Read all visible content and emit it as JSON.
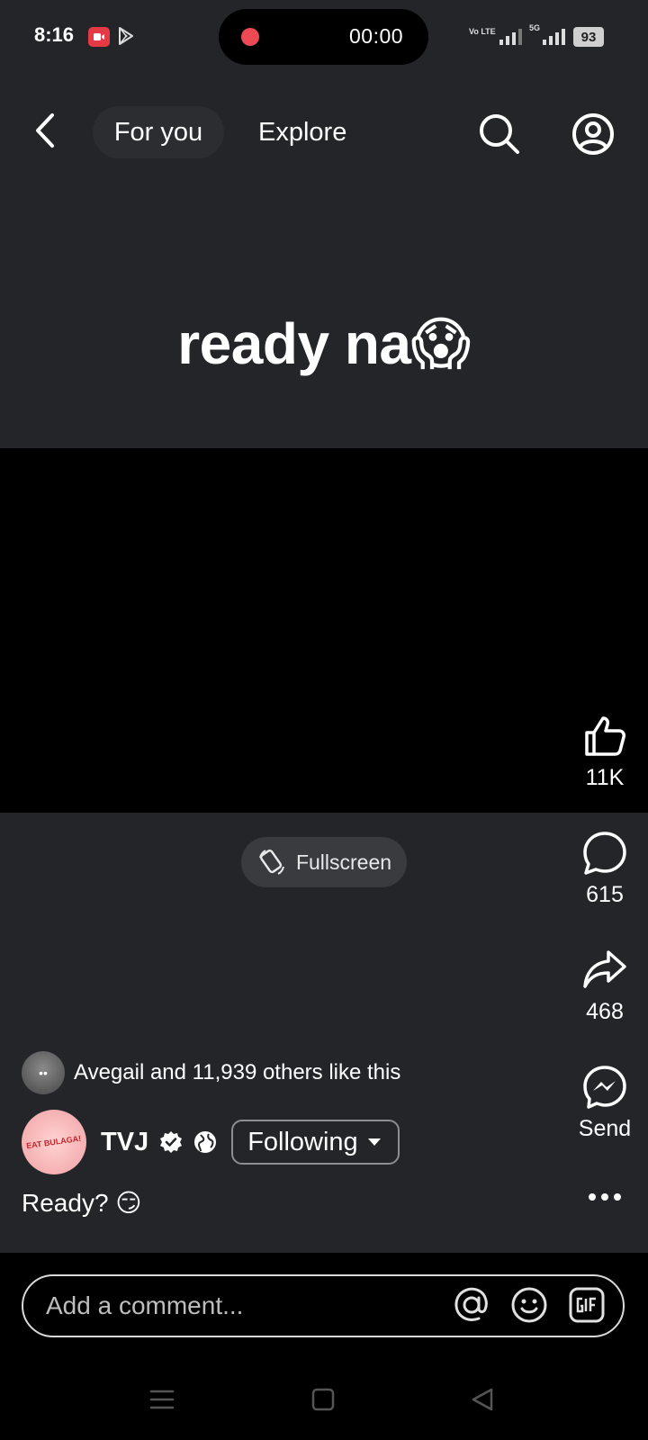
{
  "status_bar": {
    "time": "8:16",
    "screen_record_timer": "00:00",
    "network_volte": "Vo LTE",
    "network_5g": "5G",
    "battery": "93"
  },
  "top_nav": {
    "tab_for_you": "For you",
    "tab_explore": "Explore"
  },
  "video": {
    "caption": "ready na😱"
  },
  "fullscreen_label": "Fullscreen",
  "actions": {
    "like_count": "11K",
    "comment_count": "615",
    "share_count": "468",
    "send_label": "Send"
  },
  "post": {
    "likes_avatar_initials": "••",
    "likes_text": "Avegail and 11,939 others like this",
    "author_logo_text": "EAT BULAGA!",
    "author_name": "TVJ",
    "follow_state": "Following",
    "text": "Ready? 😏"
  },
  "comment_bar": {
    "placeholder": "Add a comment..."
  },
  "colors": {
    "background": "#242528",
    "video_black": "#000000",
    "record_dot": "#ee4a56"
  }
}
